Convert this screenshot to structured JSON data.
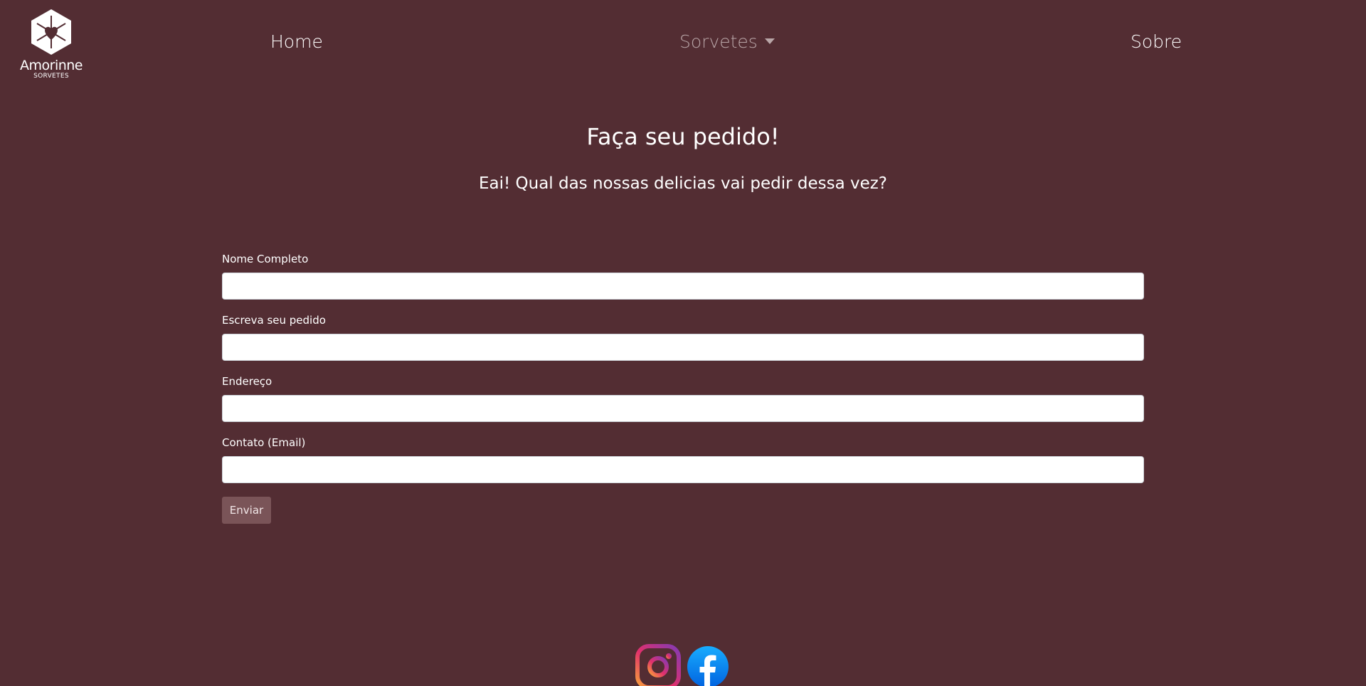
{
  "brand": {
    "name": "Amorinne",
    "tagline": "SORVETES"
  },
  "nav": {
    "home": "Home",
    "sorvetes": "Sorvetes",
    "sobre": "Sobre"
  },
  "page": {
    "title": "Faça seu pedido!",
    "subtitle": "Eai! Qual das nossas delicias vai pedir dessa vez?"
  },
  "form": {
    "fields": [
      {
        "label": "Nome Completo",
        "value": ""
      },
      {
        "label": "Escreva seu pedido",
        "value": ""
      },
      {
        "label": "Endereço",
        "value": ""
      },
      {
        "label": "Contato (Email)",
        "value": ""
      }
    ],
    "submit_label": "Enviar"
  },
  "social": {
    "icons": [
      "instagram-icon",
      "facebook-icon"
    ]
  },
  "colors": {
    "background": "#532d33",
    "button": "#7a5458",
    "nav_active": "#b9a6a8"
  }
}
